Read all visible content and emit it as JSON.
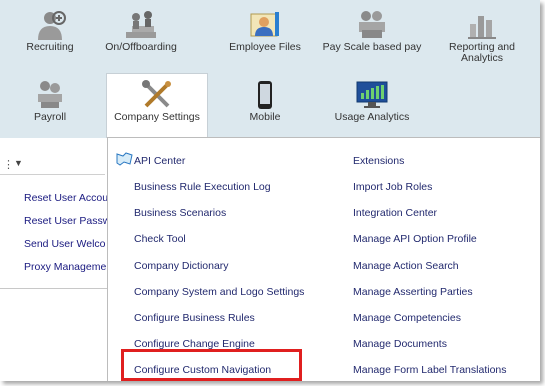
{
  "tiles": [
    {
      "label": "Recruiting",
      "icon": "recruiting-icon"
    },
    {
      "label": "On/Offboarding",
      "icon": "onboarding-icon"
    },
    {
      "label": "Employee Files",
      "icon": "employee-files-icon"
    },
    {
      "label": "Pay Scale based pay",
      "icon": "pay-scale-icon"
    },
    {
      "label": "Reporting and Analytics",
      "icon": "reporting-icon"
    },
    {
      "label": "Payroll",
      "icon": "payroll-icon"
    },
    {
      "label": "Company Settings",
      "icon": "company-settings-icon"
    },
    {
      "label": "Mobile",
      "icon": "mobile-icon"
    },
    {
      "label": "Usage Analytics",
      "icon": "usage-analytics-icon"
    }
  ],
  "left_menu": {
    "items": [
      "Reset User Accou",
      "Reset User Passw",
      "Send User Welco",
      "Proxy Manageme"
    ]
  },
  "dropdown": {
    "col1": [
      "API Center",
      "Business Rule Execution Log",
      "Business Scenarios",
      "Check Tool",
      "Company Dictionary",
      "Company System and Logo Settings",
      "Configure Business Rules",
      "Configure Change Engine",
      "Configure Custom Navigation"
    ],
    "col2": [
      "Extensions",
      "Import Job Roles",
      "Integration Center",
      "Manage API Option Profile",
      "Manage Action Search",
      "Manage Asserting Parties",
      "Manage Competencies",
      "Manage Documents",
      "Manage Form Label Translations"
    ]
  },
  "colors": {
    "panel_bg": "#dce8ee",
    "link": "#22296e",
    "highlight": "#e01f1f"
  }
}
